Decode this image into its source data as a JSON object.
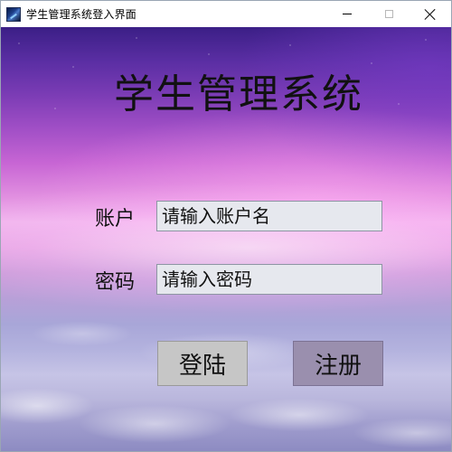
{
  "window": {
    "title": "学生管理系统登入界面",
    "controls": {
      "minimize": "minimize",
      "maximize": "maximize",
      "close": "close"
    }
  },
  "app": {
    "heading": "学生管理系统"
  },
  "form": {
    "account": {
      "label": "账户",
      "value": "请输入账户名"
    },
    "password": {
      "label": "密码",
      "value": "请输入密码"
    }
  },
  "buttons": {
    "login": "登陆",
    "register": "注册"
  },
  "colors": {
    "login_button": "#c6c6c6",
    "register_button": "#9a8fae",
    "field_background": "#e6e8ee"
  }
}
